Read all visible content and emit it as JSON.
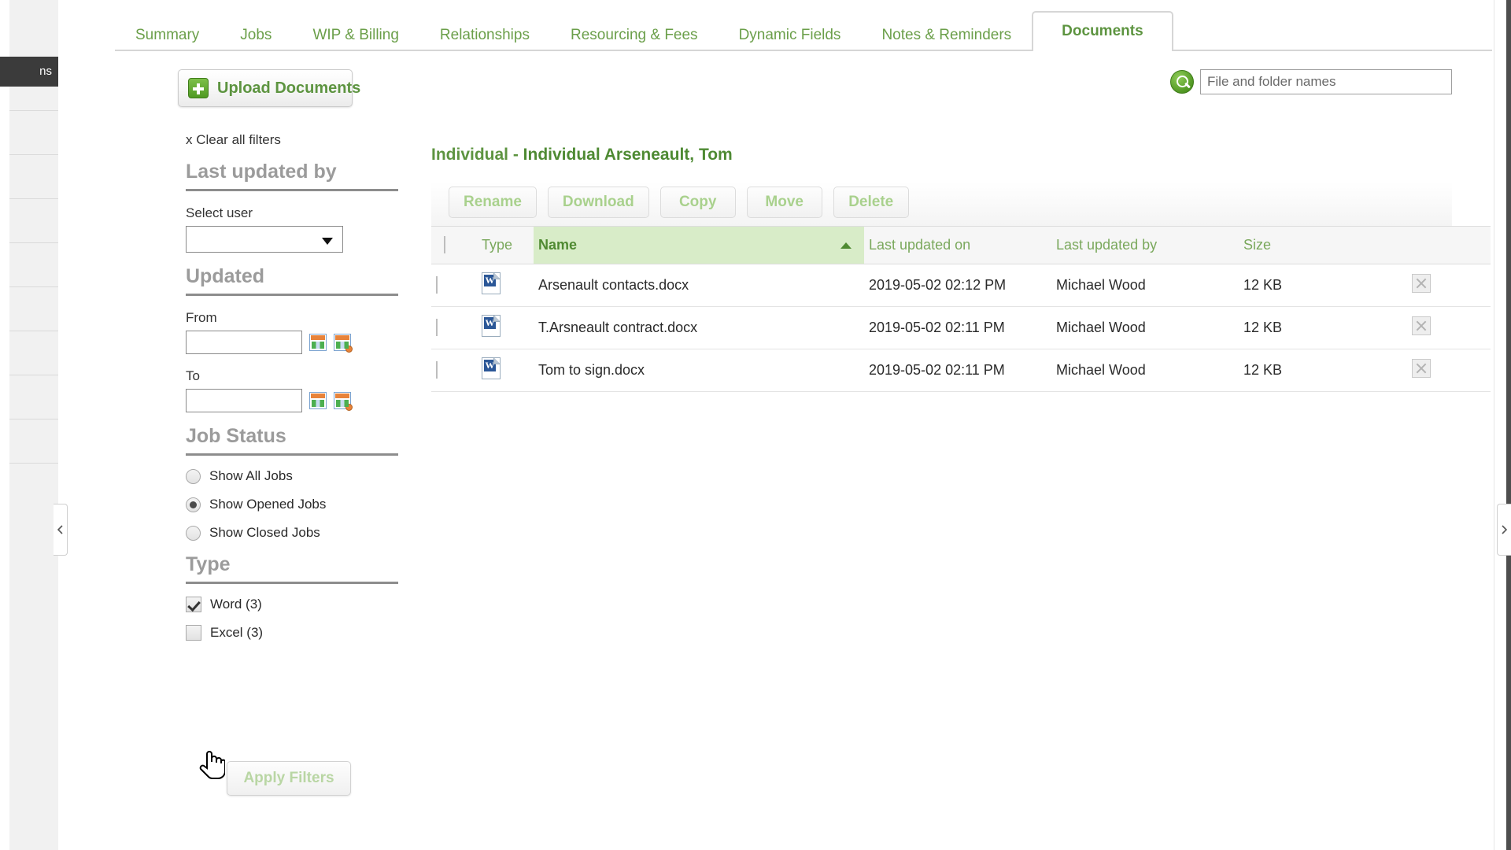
{
  "left_chrome": {
    "active_nav_label": "ns"
  },
  "tabs": [
    {
      "label": "Summary",
      "active": false
    },
    {
      "label": "Jobs",
      "active": false
    },
    {
      "label": "WIP & Billing",
      "active": false
    },
    {
      "label": "Relationships",
      "active": false
    },
    {
      "label": "Resourcing & Fees",
      "active": false
    },
    {
      "label": "Dynamic Fields",
      "active": false
    },
    {
      "label": "Notes & Reminders",
      "active": false
    },
    {
      "label": "Documents",
      "active": true
    }
  ],
  "toolbar": {
    "upload_label": "Upload Documents",
    "upload_icon": "plus-icon"
  },
  "search": {
    "placeholder": "File and folder names",
    "value": "",
    "icon": "search-icon"
  },
  "filters": {
    "clear_all": "x Clear all filters",
    "last_updated_by": {
      "heading": "Last updated by",
      "sub_label": "Select user",
      "selected": ""
    },
    "updated": {
      "heading": "Updated",
      "from_label": "From",
      "from_value": "",
      "to_label": "To",
      "to_value": "",
      "calendar_icon": "calendar-icon",
      "calendar_clear_icon": "calendar-clear-icon"
    },
    "job_status": {
      "heading": "Job Status",
      "options": [
        {
          "label": "Show All Jobs",
          "selected": false
        },
        {
          "label": "Show Opened Jobs",
          "selected": true
        },
        {
          "label": "Show Closed Jobs",
          "selected": false
        }
      ]
    },
    "type": {
      "heading": "Type",
      "options": [
        {
          "label": "Word (3)",
          "checked": true
        },
        {
          "label": "Excel (3)",
          "checked": false
        }
      ]
    },
    "apply_label": "Apply Filters"
  },
  "content": {
    "breadcrumb_prefix": "Individual - ",
    "breadcrumb_name": "Individual Arseneault, Tom",
    "actions": [
      {
        "label": "Rename",
        "enabled": false
      },
      {
        "label": "Download",
        "enabled": false
      },
      {
        "label": "Copy",
        "enabled": false
      },
      {
        "label": "Move",
        "enabled": false
      },
      {
        "label": "Delete",
        "enabled": false
      }
    ],
    "table": {
      "columns": [
        "Type",
        "Name",
        "Last updated on",
        "Last updated by",
        "Size"
      ],
      "sorted_column": "Name",
      "sort_direction": "asc",
      "rows": [
        {
          "type_icon": "word-document-icon",
          "name": "Arsenault contacts.docx",
          "last_updated_on": "2019-05-02 02:12 PM",
          "last_updated_by": "Michael Wood",
          "size": "12 KB",
          "checked": false
        },
        {
          "type_icon": "word-document-icon",
          "name": "T.Arsneault contract.docx",
          "last_updated_on": "2019-05-02 02:11 PM",
          "last_updated_by": "Michael Wood",
          "size": "12 KB",
          "checked": false
        },
        {
          "type_icon": "word-document-icon",
          "name": "Tom to sign.docx",
          "last_updated_on": "2019-05-02 02:11 PM",
          "last_updated_by": "Michael Wood",
          "size": "12 KB",
          "checked": false
        }
      ]
    }
  },
  "colors": {
    "accent_green": "#5d9440",
    "tab_green": "#6b9f4a",
    "sorted_header_bg": "#d8ecc8",
    "heading_gray": "#9b9b9b"
  }
}
